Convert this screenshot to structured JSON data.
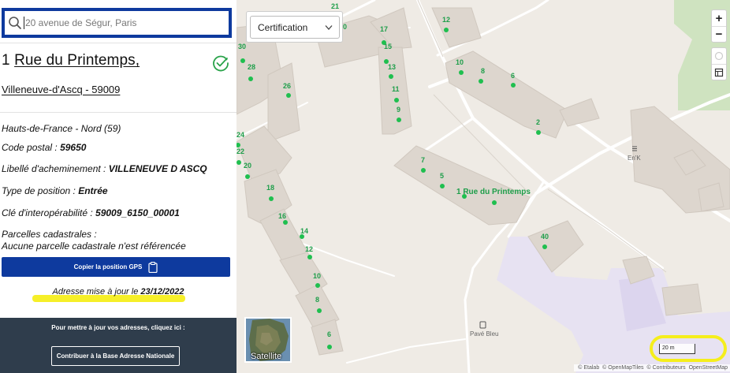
{
  "search": {
    "placeholder": "20 avenue de Ségur, Paris"
  },
  "address": {
    "street_number": "1",
    "street_name": "Rue du Printemps,",
    "city_line": "Villeneuve-d'Ascq - 59009",
    "verified_icon": "check-circle-icon"
  },
  "details": {
    "region": "Hauts-de-France - Nord (59)",
    "postal_label": "Code postal :",
    "postal_value": "59650",
    "delivery_label": "Libellé d'acheminement :",
    "delivery_value": "VILLENEUVE D ASCQ",
    "position_label": "Type de position :",
    "position_value": "Entrée",
    "interop_label": "Clé d'interopérabilité :",
    "interop_value": "59009_6150_00001",
    "parcels_label": "Parcelles cadastrales :",
    "parcels_value": "Aucune parcelle cadastrale n'est référencée"
  },
  "gps_button": {
    "label": "Copier la position GPS",
    "icon": "clipboard-icon"
  },
  "updated": {
    "prefix": "Adresse mise à jour le",
    "date": "23/12/2022"
  },
  "footer": {
    "text": "Pour mettre à jour vos adresses, cliquez ici :",
    "button_label": "Contribuer à la Base Adresse Nationale"
  },
  "map": {
    "layer_select": {
      "value": "Certification"
    },
    "zoom_in": "+",
    "zoom_out": "−",
    "satellite_label": "Satellite",
    "scale_label": "20 m",
    "attribution": [
      "© Etalab",
      "© OpenMapTiles",
      "© Contributeurs",
      "OpenStreetMap"
    ],
    "poi": [
      {
        "label": "En'K",
        "icon": "restaurant-icon"
      },
      {
        "label": "Pavé Bleu",
        "icon": "bus-stop-icon"
      }
    ],
    "main_label": "1 Rue du Printemps",
    "numbers": [
      "21",
      "12",
      "20",
      "17",
      "30",
      "15",
      "28",
      "13",
      "10",
      "8",
      "6",
      "26",
      "11",
      "9",
      "2",
      "24",
      "22",
      "7",
      "20",
      "5",
      "18",
      "16",
      "40",
      "14",
      "12",
      "10",
      "8",
      "6"
    ],
    "colors": {
      "marker": "#1fbf4f",
      "highlight": "#f5ee1c",
      "brand": "#0e3a9e"
    }
  }
}
